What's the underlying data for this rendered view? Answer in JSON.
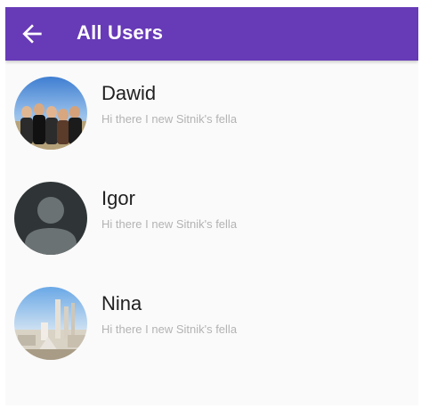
{
  "appbar": {
    "title": "All Users",
    "back_icon": "arrow-left-icon",
    "background": "#673ab7"
  },
  "users": [
    {
      "name": "Dawid",
      "status": "Hi there I new Sitnik's fella",
      "avatar": "group-photo"
    },
    {
      "name": "Igor",
      "status": "Hi there I new Sitnik's fella",
      "avatar": "default-person-icon"
    },
    {
      "name": "Nina",
      "status": "Hi there I new Sitnik's fella",
      "avatar": "city-photo"
    }
  ]
}
